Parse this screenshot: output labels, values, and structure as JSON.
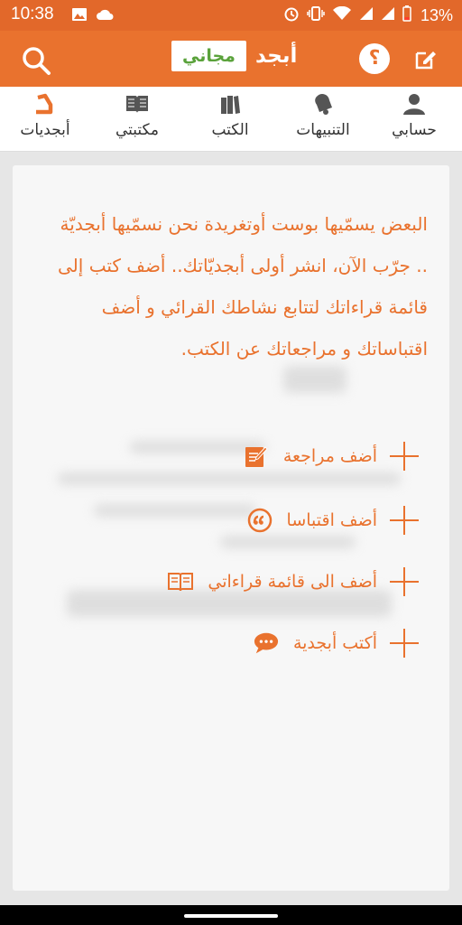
{
  "status_bar": {
    "time": "10:38",
    "battery": "13%",
    "icons": [
      "image-icon",
      "cloud-icon",
      "alarm-icon",
      "vibrate-icon",
      "wifi-icon",
      "signal-icon",
      "signal-icon",
      "battery-low-icon"
    ]
  },
  "app_bar": {
    "free_badge": "مجاني",
    "app_name": "أبجد",
    "help_label": "؟",
    "accent_color": "#e9722e",
    "badge_text_color": "#5aa23b"
  },
  "tabs": [
    {
      "label": "حسابي",
      "icon": "user-icon"
    },
    {
      "label": "التنبيهات",
      "icon": "bell-icon"
    },
    {
      "label": "الكتب",
      "icon": "books-icon"
    },
    {
      "label": "مكتبتي",
      "icon": "open-book-icon"
    },
    {
      "label": "أبجديات",
      "icon": "abjad-logo-icon",
      "active": true
    }
  ],
  "intro_text": "البعض يسمّيها بوست أوتغريدة نحن نسمّيها أبجديّة .. جرّب الآن، انشر أولى أبجديّاتك.. أضف كتب إلى قائمة قراءاتك لتتابع نشاطك القرائي و أضف اقتباساتك و مراجعاتك عن الكتب.",
  "actions": [
    {
      "label": "أضف مراجعة",
      "icon": "edit-icon"
    },
    {
      "label": "أضف اقتباسا",
      "icon": "quote-icon"
    },
    {
      "label": "أضف الى قائمة قراءاتي",
      "icon": "reading-list-icon"
    },
    {
      "label": "أكتب أبجدية",
      "icon": "chat-bubble-icon"
    }
  ]
}
